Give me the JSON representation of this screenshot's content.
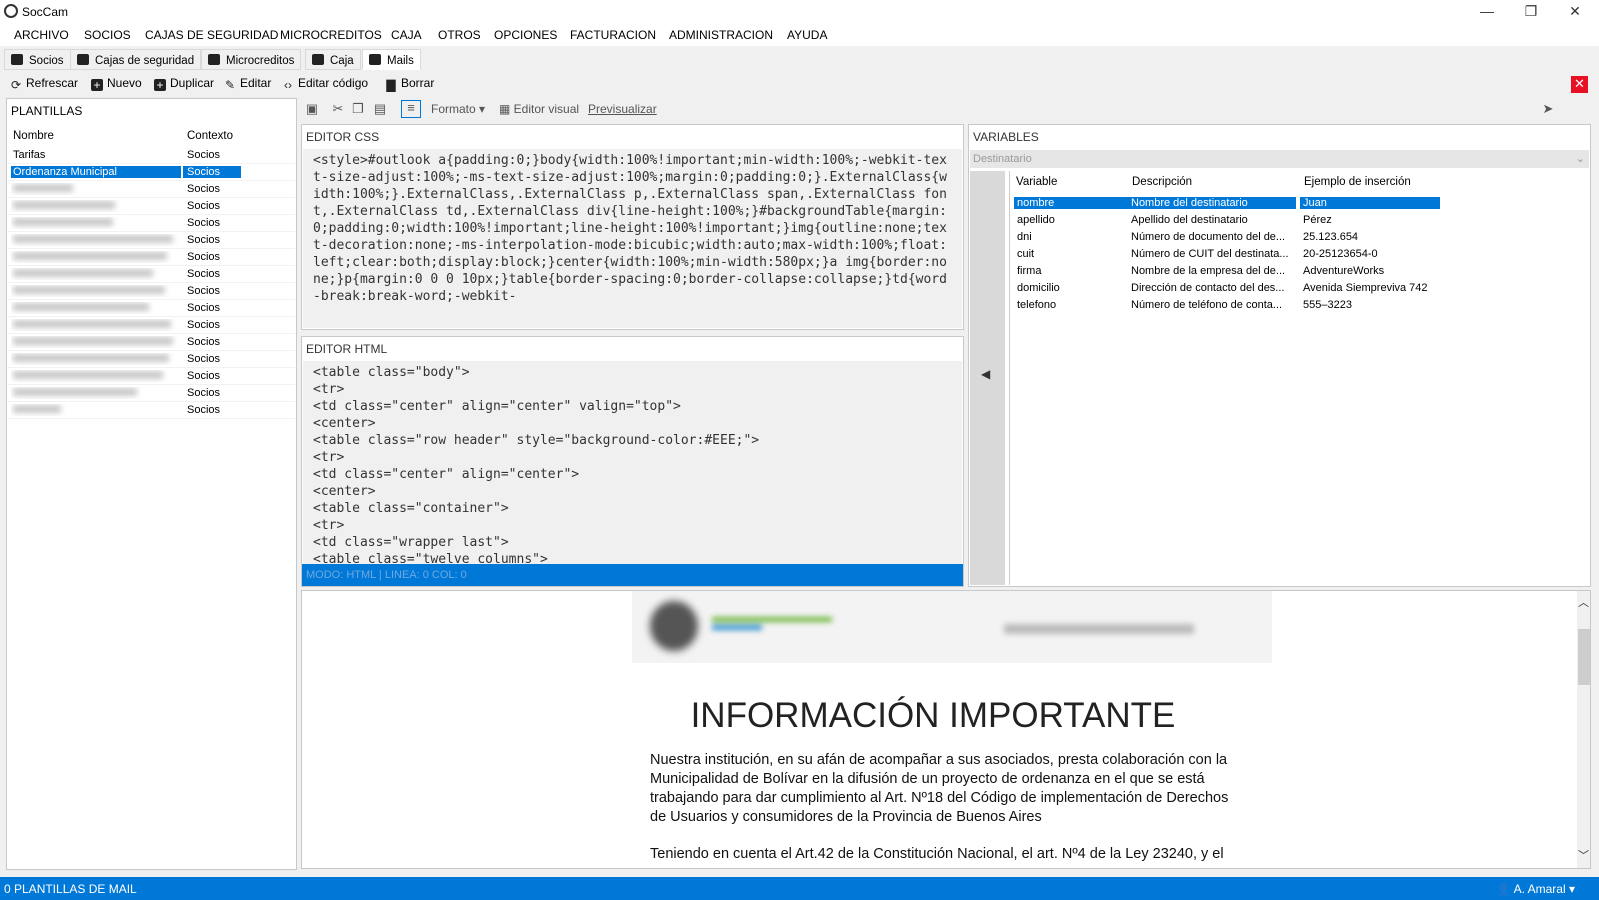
{
  "window": {
    "title": "SocCam",
    "minimize": "—",
    "restore": "❐",
    "close": "✕"
  },
  "menu": [
    "ARCHIVO",
    "SOCIOS",
    "CAJAS DE SEGURIDAD",
    "MICROCREDITOS",
    "CAJA",
    "OTROS",
    "OPCIONES",
    "FACTURACION",
    "ADMINISTRACION",
    "AYUDA"
  ],
  "tabs": [
    {
      "label": "Socios",
      "icon": "user-icon"
    },
    {
      "label": "Cajas de seguridad",
      "icon": "safe-icon"
    },
    {
      "label": "Microcreditos",
      "icon": "bank-icon"
    },
    {
      "label": "Caja",
      "icon": "cash-icon"
    },
    {
      "label": "Mails",
      "icon": "mail-icon",
      "active": true
    }
  ],
  "toolbar": {
    "refresh": "Refrescar",
    "new": "Nuevo",
    "duplicate": "Duplicar",
    "edit": "Editar",
    "edit_code": "Editar código",
    "delete": "Borrar",
    "close": "✕"
  },
  "templates": {
    "title": "PLANTILLAS",
    "col_name": "Nombre",
    "col_context": "Contexto",
    "rows": [
      {
        "name": "Tarifas",
        "context": "Socios"
      },
      {
        "name": "Ordenanza Municipal",
        "context": "Socios",
        "selected": true
      },
      {
        "name": "",
        "context": "Socios"
      },
      {
        "name": "",
        "context": "Socios"
      },
      {
        "name": "",
        "context": "Socios"
      },
      {
        "name": "",
        "context": "Socios"
      },
      {
        "name": "",
        "context": "Socios"
      },
      {
        "name": "",
        "context": "Socios"
      },
      {
        "name": "",
        "context": "Socios"
      },
      {
        "name": "",
        "context": "Socios"
      },
      {
        "name": "",
        "context": "Socios"
      },
      {
        "name": "",
        "context": "Socios"
      },
      {
        "name": "",
        "context": "Socios"
      },
      {
        "name": "",
        "context": "Socios"
      },
      {
        "name": "",
        "context": "Socios"
      },
      {
        "name": "",
        "context": "Socios"
      }
    ]
  },
  "editor_toolbar": {
    "format": "Formato",
    "visual_editor": "Editor visual",
    "preview": "Previsualizar"
  },
  "css_editor": {
    "title": "EDITOR CSS",
    "code": "<style>#outlook a{padding:0;}body{width:100%!important;min-width:100%;-webkit-text-size-adjust:100%;-ms-text-size-adjust:100%;margin:0;padding:0;}.ExternalClass{width:100%;}.ExternalClass,.ExternalClass p,.ExternalClass span,.ExternalClass font,.ExternalClass td,.ExternalClass div{line-height:100%;}#backgroundTable{margin:0;padding:0;width:100%!important;line-height:100%!important;}img{outline:none;text-decoration:none;-ms-interpolation-mode:bicubic;width:auto;max-width:100%;float:left;clear:both;display:block;}center{width:100%;min-width:580px;}a img{border:none;}p{margin:0 0 0 10px;}table{border-spacing:0;border-collapse:collapse;}td{word-break:break-word;-webkit-"
  },
  "html_editor": {
    "title": "EDITOR HTML",
    "lines": [
      "<table class=\"body\">",
      "<tr>",
      "<td class=\"center\" align=\"center\" valign=\"top\">",
      "<center>",
      "<table class=\"row header\" style=\"background-color:#EEE;\">",
      "<tr>",
      "<td class=\"center\" align=\"center\">",
      "<center>",
      "<table class=\"container\">",
      "<tr>",
      "<td class=\"wrapper last\">",
      "<table class=\"twelve columns\">"
    ],
    "status": "MODO: HTML | LINEA: 0 COL: 0"
  },
  "variables": {
    "title": "VARIABLES",
    "dropdown": "Destinatario",
    "col_var": "Variable",
    "col_desc": "Descripción",
    "col_example": "Ejemplo de inserción",
    "rows": [
      {
        "var": "nombre",
        "desc": "Nombre del destinatario",
        "example": "Juan",
        "selected": true
      },
      {
        "var": "apellido",
        "desc": "Apellido del destinatario",
        "example": "Pérez"
      },
      {
        "var": "dni",
        "desc": "Número de documento del de...",
        "example": "25.123.654"
      },
      {
        "var": "cuit",
        "desc": "Número de CUIT del destinata...",
        "example": "20-25123654-0"
      },
      {
        "var": "firma",
        "desc": "Nombre de la empresa del de...",
        "example": "AdventureWorks"
      },
      {
        "var": "domicilio",
        "desc": "Dirección de contacto del des...",
        "example": "Avenida Siempreviva 742"
      },
      {
        "var": "telefono",
        "desc": "Número de teléfono de conta...",
        "example": "555–3223"
      }
    ]
  },
  "preview": {
    "title": "INFORMACIÓN IMPORTANTE",
    "paragraph1": "Nuestra institución, en su afán de acompañar a sus asociados, presta colaboración con la Municipalidad de Bolívar en la difusión de un proyecto de ordenanza en el que se está trabajando para dar cumplimiento al Art. Nº18 del Código de implementación de Derechos de Usuarios y consumidores de la Provincia de Buenos Aires",
    "paragraph2": "Teniendo en cuenta el Art.42 de la Constitución Nacional, el art. Nº4 de la Ley 23240, y el"
  },
  "statusbar": {
    "left": "0 PLANTILLAS DE MAIL",
    "user": "A. Amaral"
  },
  "colors": {
    "accent": "#0078d7",
    "close_red": "#e81123"
  }
}
